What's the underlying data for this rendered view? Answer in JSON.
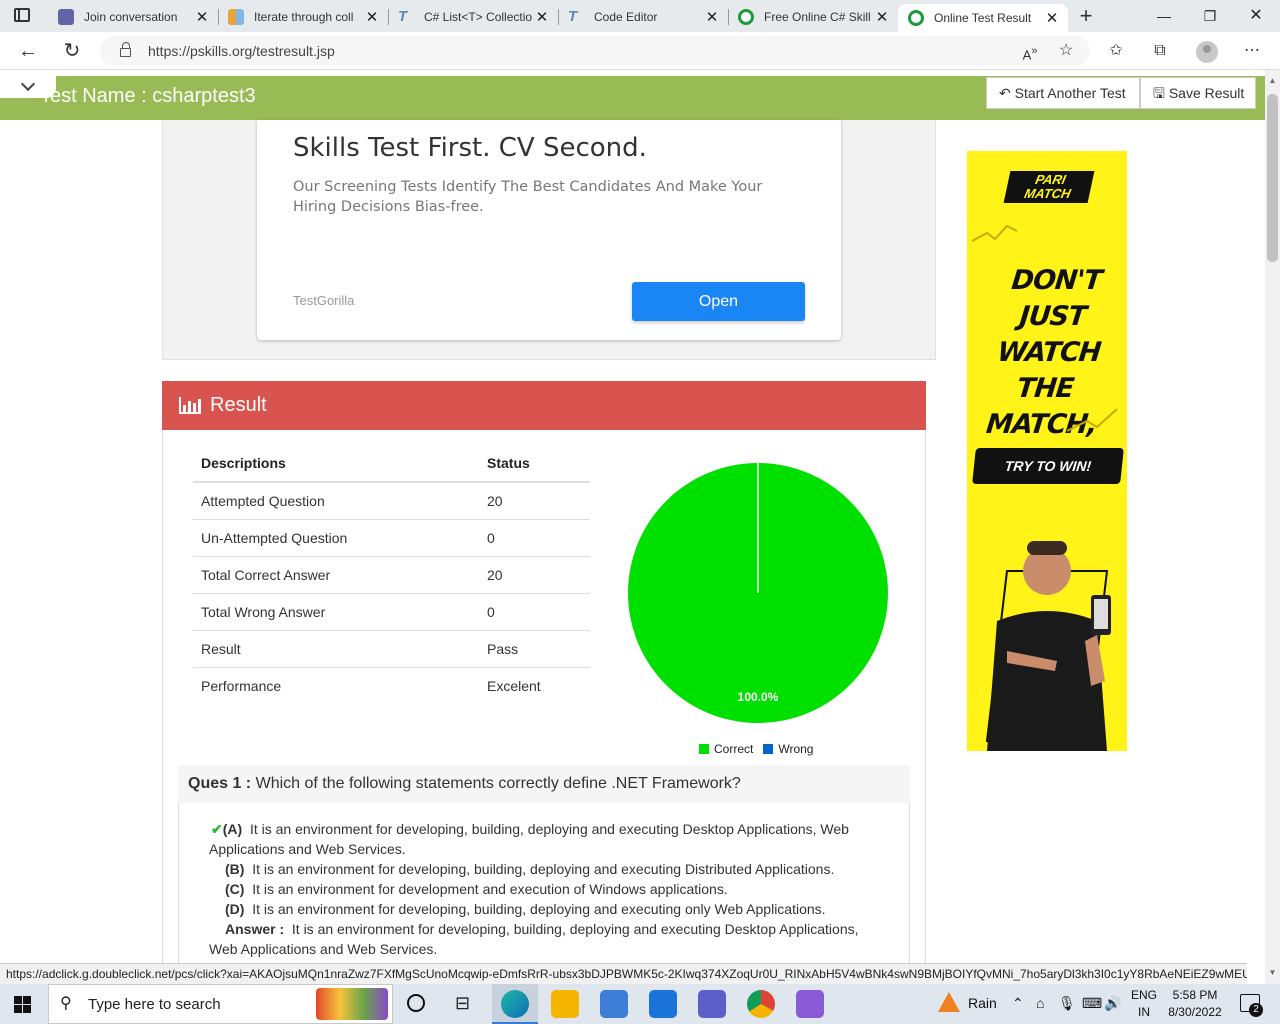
{
  "browser": {
    "tabs": [
      {
        "label": "Join conversation",
        "color": "#6264a7"
      },
      {
        "label": "Iterate through coll",
        "color": "#e8a33d"
      },
      {
        "label": "C# List<T> Collectio",
        "color": "#5b8ab5"
      },
      {
        "label": "Code Editor",
        "color": "#5b8ab5"
      },
      {
        "label": "Free Online C# Skill",
        "color": "#1a9c3a"
      },
      {
        "label": "Online Test Result",
        "color": "#1a9c3a"
      }
    ],
    "url": "https://pskills.org/testresult.jsp",
    "status_url": "https://adclick.g.doubleclick.net/pcs/click?xai=AKAOjsuMQn1nraZwz7FXfMgScUnoMcqwip-eDmfsRrR-ubsx3bDJPBWMK5c-2KIwq374XZoqUr0U_RINxAbH5V4wBNk4swN9BMjBOIYfQvMNi_7ho5aryDl3kh3I0c1yY8RbAeNEiEZ9wMEULf..."
  },
  "header": {
    "test_name": "Test Name : csharptest3",
    "start_another_label": "Start Another Test",
    "save_result_label": "Save Result",
    "accent": "#99bb55"
  },
  "ad": {
    "title": "Skills Test First. CV Second.",
    "body": "Our Screening Tests Identify The Best Candidates And Make Your Hiring Decisions Bias-free.",
    "brand": "TestGorilla",
    "cta": "Open"
  },
  "result": {
    "heading": "Result",
    "header_color": "#d9534f",
    "columns": [
      "Descriptions",
      "Status"
    ],
    "rows": [
      [
        "Attempted Question",
        "20"
      ],
      [
        "Un-Attempted Question",
        "0"
      ],
      [
        "Total Correct Answer",
        "20"
      ],
      [
        "Total Wrong Answer",
        "0"
      ],
      [
        "Result",
        "Pass"
      ],
      [
        "Performance",
        "Excelent"
      ]
    ]
  },
  "chart_data": {
    "type": "pie",
    "labels": [
      "Correct",
      "Wrong"
    ],
    "values": [
      20,
      0
    ],
    "colors": [
      "#00e000",
      "#0066cc"
    ],
    "data_labels": [
      "100.0%"
    ],
    "legend": "bottom"
  },
  "question": {
    "label": "Ques 1 :",
    "text": "Which of the following statements correctly define .NET Framework?",
    "options": [
      {
        "key": "(A)",
        "text": "It is an environment for developing, building, deploying and executing Desktop Applications, Web Applications and Web Services.",
        "correct": true
      },
      {
        "key": "(B)",
        "text": "It is an environment for developing, building, deploying and executing Distributed Applications."
      },
      {
        "key": "(C)",
        "text": "It is an environment for development and execution of Windows applications."
      },
      {
        "key": "(D)",
        "text": "It is an environment for developing, building, deploying and executing only Web Applications."
      }
    ],
    "answer_label": "Answer :",
    "answer_text": "It is an environment for developing, building, deploying and executing Desktop Applications, Web Applications and Web Services."
  },
  "sidebar_ad": {
    "logo_line1": "PARI",
    "logo_line2": "MATCH",
    "headline": "DON'T JUST WATCH THE MATCH, PLAY IT!",
    "cta": "TRY TO WIN!",
    "bg": "#fff318"
  },
  "taskbar": {
    "search_placeholder": "Type here to search",
    "weather": "Rain",
    "lang_line1": "ENG",
    "lang_line2": "IN",
    "time": "5:58 PM",
    "date": "8/30/2022",
    "notifications": "2"
  }
}
